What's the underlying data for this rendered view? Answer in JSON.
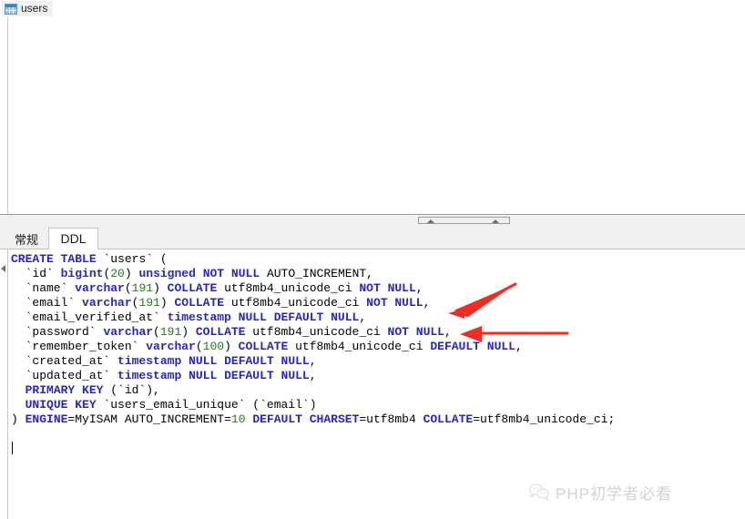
{
  "window": {
    "doc_tab": {
      "label": "users",
      "icon": "table-grid-icon"
    }
  },
  "splitter": {
    "collapse_up_icon": "triangle-up-icon"
  },
  "bottom_tabs": {
    "items": [
      {
        "label": "常规",
        "active": false
      },
      {
        "label": "DDL",
        "active": true
      }
    ]
  },
  "editor": {
    "gutter_icon": "collapse-arrow-icon",
    "language": "sql",
    "lines": [
      "CREATE TABLE `users` (",
      "  `id` bigint(20) unsigned NOT NULL AUTO_INCREMENT,",
      "  `name` varchar(191) COLLATE utf8mb4_unicode_ci NOT NULL,",
      "  `email` varchar(191) COLLATE utf8mb4_unicode_ci NOT NULL,",
      "  `email_verified_at` timestamp NULL DEFAULT NULL,",
      "  `password` varchar(191) COLLATE utf8mb4_unicode_ci NOT NULL,",
      "  `remember_token` varchar(100) COLLATE utf8mb4_unicode_ci DEFAULT NULL,",
      "  `created_at` timestamp NULL DEFAULT NULL,",
      "  `updated_at` timestamp NULL DEFAULT NULL,",
      "  PRIMARY KEY (`id`),",
      "  UNIQUE KEY `users_email_unique` (`email`)",
      ") ENGINE=MyISAM AUTO_INCREMENT=10 DEFAULT CHARSET=utf8mb4 COLLATE=utf8mb4_unicode_ci;",
      "",
      ""
    ],
    "table_name": "users",
    "engine": "MyISAM",
    "auto_increment": "10",
    "charset": "utf8mb4",
    "collation": "utf8mb4_unicode_ci"
  },
  "annotations": [
    {
      "name": "arrow-email-not-null",
      "target": "`email` NOT NULL",
      "color": "#ee2d24"
    },
    {
      "name": "arrow-password-not-null",
      "target": "`password` NOT NULL",
      "color": "#ee2d24"
    }
  ],
  "watermark": {
    "text": "PHP初学者必看",
    "icon": "wechat-icon"
  },
  "colors": {
    "keyword": "#2727c0",
    "number": "#237c23",
    "plain": "#000000",
    "annotation": "#ee2d24",
    "tab_active_bg": "#ffffff",
    "panel_bg": "#f0f0f0"
  }
}
